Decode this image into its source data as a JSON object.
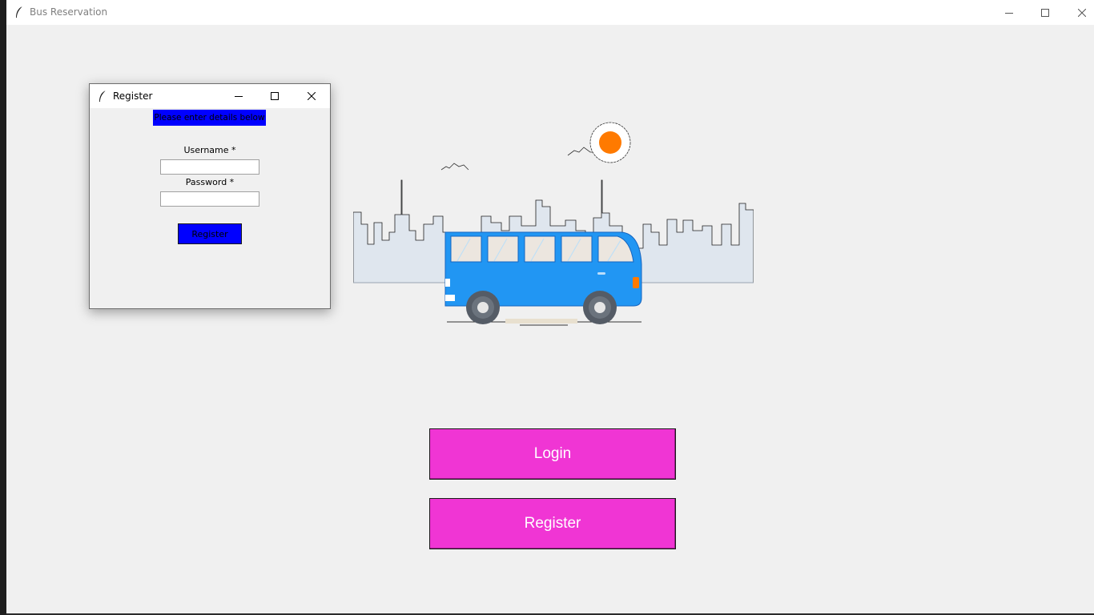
{
  "main_window": {
    "title": "Bus Reservation",
    "buttons": {
      "login_label": "Login",
      "register_label": "Register"
    }
  },
  "dialog": {
    "title": "Register",
    "banner": "Please enter details below",
    "username_label": "Username *",
    "username_value": "",
    "password_label": "Password *",
    "password_value": "",
    "register_button": "Register"
  },
  "icons": [
    "feather-icon",
    "minimize-icon",
    "maximize-icon",
    "close-icon"
  ],
  "colors": {
    "accent_button": "#f035d4",
    "dialog_button": "#0000ff",
    "bus_body": "#2196f3",
    "sun": "#ff7a00",
    "window_bg": "#f0f0f0"
  }
}
